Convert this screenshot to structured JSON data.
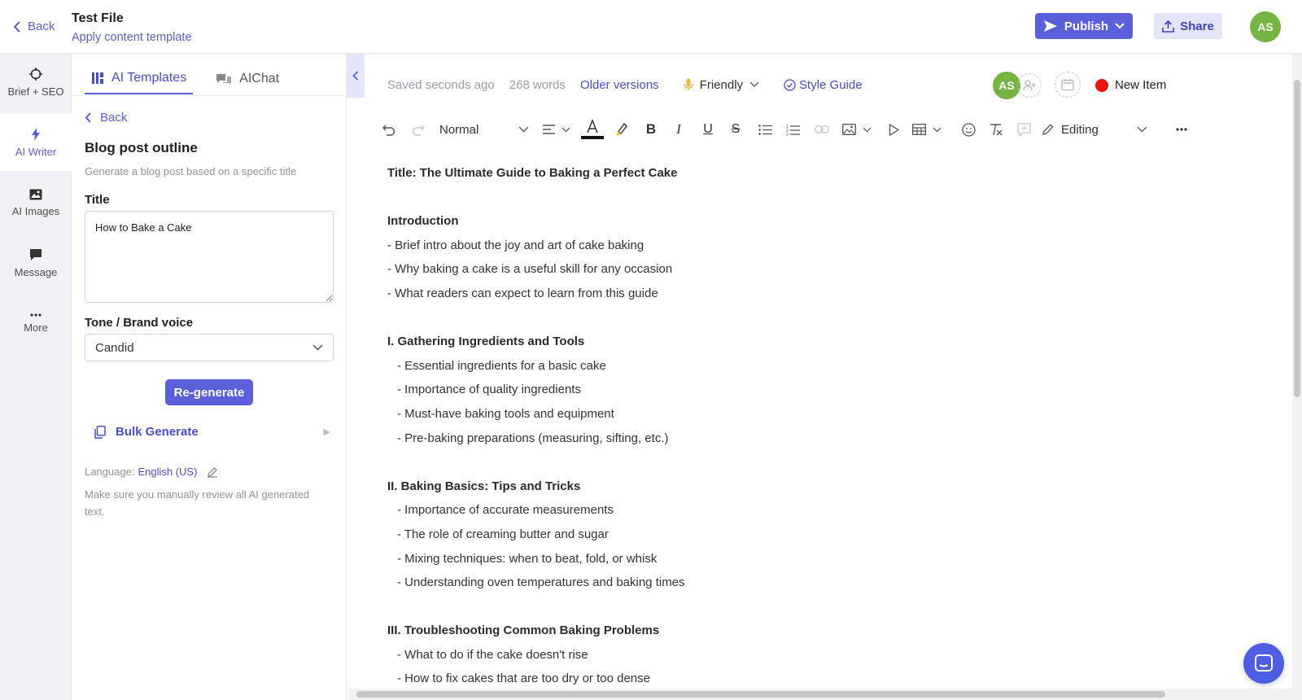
{
  "header": {
    "back_label": "Back",
    "file_title": "Test File",
    "subtitle_link": "Apply content template",
    "publish_label": "Publish",
    "share_label": "Share",
    "avatar_initials": "AS"
  },
  "rail": {
    "items": [
      {
        "label": "Brief + SEO",
        "icon": "crosshair-icon"
      },
      {
        "label": "AI Writer",
        "icon": "lightning-icon"
      },
      {
        "label": "AI Images",
        "icon": "image-icon"
      },
      {
        "label": "Message",
        "icon": "message-icon"
      },
      {
        "label": "More",
        "icon": "ellipsis-icon"
      }
    ],
    "active_index": 1
  },
  "panel": {
    "tabs": [
      "AI Templates",
      "AIChat"
    ],
    "back_label": "Back",
    "template_title": "Blog post outline",
    "template_desc": "Generate a blog post based on a specific title",
    "title_label": "Title",
    "title_value": "How to Bake a Cake",
    "tone_label": "Tone / Brand voice",
    "tone_value": "Candid",
    "regen_label": "Re-generate",
    "bulk_label": "Bulk Generate",
    "language_label": "Language:",
    "language_value": "English (US)",
    "note": "Make sure you manually review all AI generated text."
  },
  "status": {
    "saved": "Saved seconds ago",
    "words": "268 words",
    "older_versions": "Older versions",
    "tone": "Friendly",
    "style_guide": "Style Guide",
    "collab_initials": "AS",
    "new_item": "New Item"
  },
  "toolbar": {
    "block_format": "Normal",
    "mode": "Editing"
  },
  "document": {
    "lines": [
      {
        "text": "Title: The Ultimate Guide to Baking a Perfect Cake",
        "style": "bold"
      },
      {
        "text": "",
        "style": "blank"
      },
      {
        "text": "Introduction",
        "style": "bold"
      },
      {
        "text": "- Brief intro about the joy and art of cake baking",
        "style": "normal"
      },
      {
        "text": "- Why baking a cake is a useful skill for any occasion",
        "style": "normal"
      },
      {
        "text": "- What readers can expect to learn from this guide",
        "style": "normal"
      },
      {
        "text": "",
        "style": "blank"
      },
      {
        "text": "I. Gathering Ingredients and Tools",
        "style": "bold"
      },
      {
        "text": "- Essential ingredients for a basic cake",
        "style": "indent"
      },
      {
        "text": "- Importance of quality ingredients",
        "style": "indent"
      },
      {
        "text": "- Must-have baking tools and equipment",
        "style": "indent"
      },
      {
        "text": "- Pre-baking preparations (measuring, sifting, etc.)",
        "style": "indent"
      },
      {
        "text": "",
        "style": "blank"
      },
      {
        "text": "II. Baking Basics: Tips and Tricks",
        "style": "bold"
      },
      {
        "text": "- Importance of accurate measurements",
        "style": "indent"
      },
      {
        "text": "- The role of creaming butter and sugar",
        "style": "indent"
      },
      {
        "text": "- Mixing techniques: when to beat, fold, or whisk",
        "style": "indent"
      },
      {
        "text": "- Understanding oven temperatures and baking times",
        "style": "indent"
      },
      {
        "text": "",
        "style": "blank"
      },
      {
        "text": "III. Troubleshooting Common Baking Problems",
        "style": "bold"
      },
      {
        "text": "- What to do if the cake doesn't rise",
        "style": "indent"
      },
      {
        "text": "- How to fix cakes that are too dry or too dense",
        "style": "indent"
      }
    ]
  },
  "colors": {
    "accent": "#5b5fd9",
    "avatar": "#76b442",
    "status_dot": "#e8150a"
  }
}
